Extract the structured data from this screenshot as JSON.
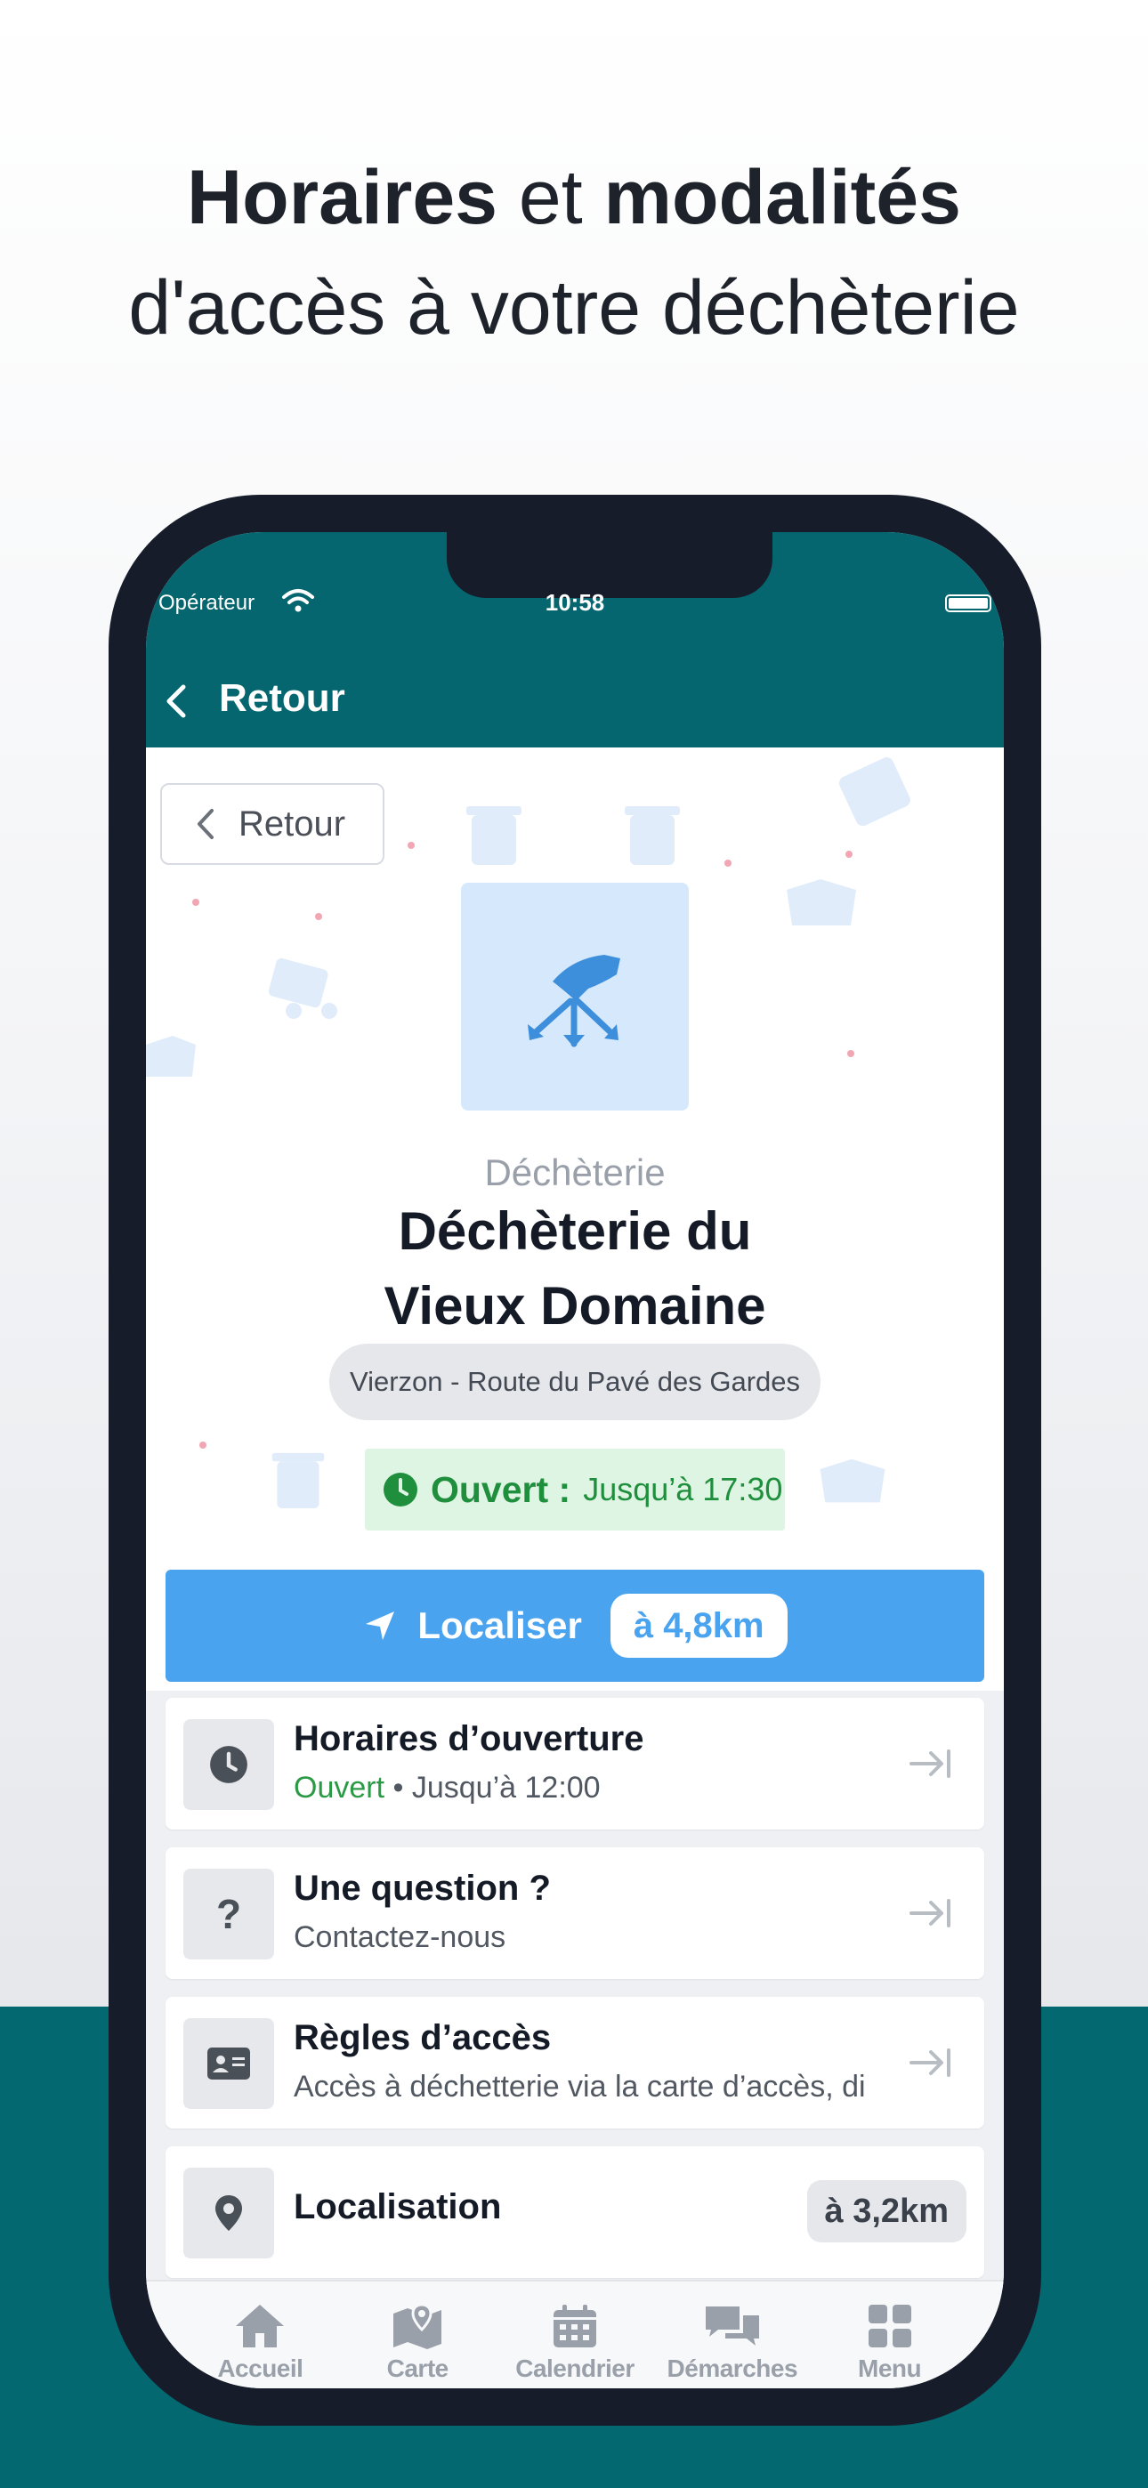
{
  "headline": {
    "line1_bold_a": "Horaires",
    "line1_reg": " et ",
    "line1_bold_b": "modalités",
    "line2": "d'accès à votre déchèterie"
  },
  "status_bar": {
    "carrier": "Opérateur",
    "time": "10:58"
  },
  "navbar": {
    "back_label": "Retour"
  },
  "page": {
    "back_button_label": "Retour",
    "category": "Déchèterie",
    "title_line1": "Déchèterie du",
    "title_line2": "Vieux Domaine",
    "address": "Vierzon - Route du Pavé des Gardes",
    "open_label": "Ouvert :",
    "open_until": "Jusqu’à 17:30",
    "locate_label": "Localiser",
    "locate_distance": "à 4,8km"
  },
  "cards": [
    {
      "title": "Horaires d’ouverture",
      "status": "Ouvert",
      "separator": "•",
      "subtitle": "Jusqu’à 12:00",
      "icon": "clock-icon"
    },
    {
      "title": "Une question ?",
      "subtitle": "Contactez-nous",
      "icon": "question-icon",
      "glyph": "?"
    },
    {
      "title": "Règles d’accès",
      "subtitle": "Accès à déchetterie via la carte d’accès, di",
      "icon": "id-card-icon"
    },
    {
      "title": "Localisation",
      "distance": "à 3,2km",
      "icon": "map-pin-icon"
    }
  ],
  "tabbar": {
    "items": [
      {
        "label": "Accueil",
        "icon": "home-icon"
      },
      {
        "label": "Carte",
        "icon": "map-icon"
      },
      {
        "label": "Calendrier",
        "icon": "calendar-icon"
      },
      {
        "label": "Démarches",
        "icon": "chat-icon"
      },
      {
        "label": "Menu",
        "icon": "grid-icon"
      }
    ]
  },
  "colors": {
    "teal": "#05666f",
    "accent_blue": "#4aa3ee",
    "open_green": "#1f8f3e"
  }
}
